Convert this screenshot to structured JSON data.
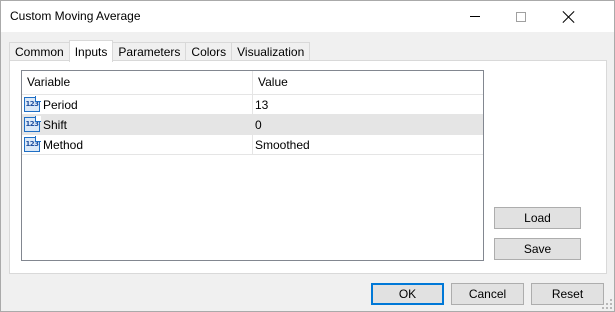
{
  "window": {
    "title": "Custom Moving Average"
  },
  "tabs": [
    {
      "label": "Common",
      "active": false
    },
    {
      "label": "Inputs",
      "active": true
    },
    {
      "label": "Parameters",
      "active": false
    },
    {
      "label": "Colors",
      "active": false
    },
    {
      "label": "Visualization",
      "active": false
    }
  ],
  "grid": {
    "columns": [
      "Variable",
      "Value"
    ],
    "rows": [
      {
        "icon": "123",
        "variable": "Period",
        "value": "13"
      },
      {
        "icon": "123",
        "variable": "Shift",
        "value": "0"
      },
      {
        "icon": "123",
        "variable": "Method",
        "value": "Smoothed"
      }
    ],
    "selected_row": 1
  },
  "side_buttons": {
    "load": "Load",
    "save": "Save"
  },
  "footer_buttons": {
    "ok": "OK",
    "cancel": "Cancel",
    "reset": "Reset"
  }
}
